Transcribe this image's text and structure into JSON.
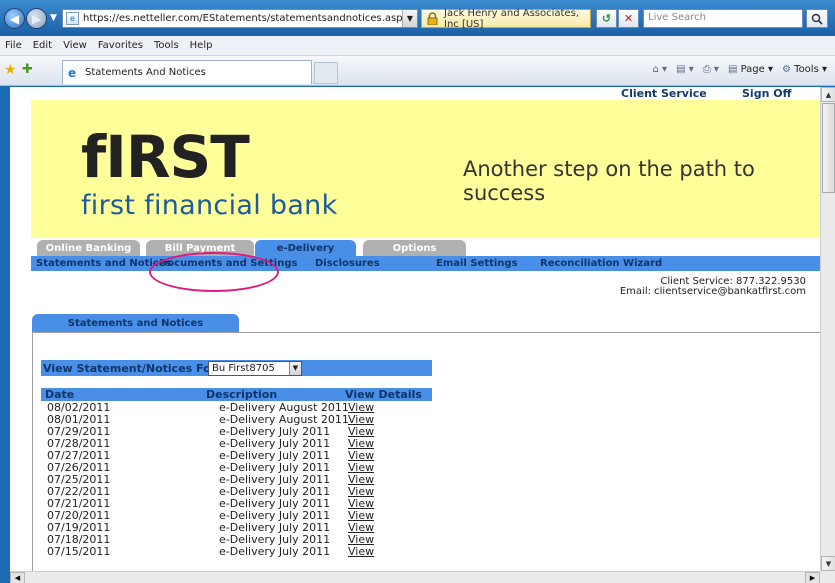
{
  "browser": {
    "url": "https://es.netteller.com/EStatements/statementsandnotices.aspx",
    "security_owner": "Jack Henry and Associates, Inc [US]",
    "search_placeholder": "Live Search",
    "menu": [
      "File",
      "Edit",
      "View",
      "Favorites",
      "Tools",
      "Help"
    ],
    "tab_title": "Statements And Notices",
    "commands": {
      "page": "Page",
      "tools": "Tools"
    }
  },
  "site": {
    "top_links": {
      "client_service": "Client Service",
      "sign_off": "Sign Off"
    },
    "logo_first": "fIRST",
    "logo_subtitle": "first financial bank",
    "tagline": "Another step on the path to success",
    "main_tabs": [
      {
        "label": "Online Banking",
        "active": false
      },
      {
        "label": "Bill Payment",
        "active": false
      },
      {
        "label": "e-Delivery",
        "active": true
      },
      {
        "label": "Options",
        "active": false
      }
    ],
    "sub_nav": [
      "Statements and Notices",
      "Documents and Settings",
      "Disclosures",
      "Email Settings",
      "Reconciliation Wizard"
    ],
    "contact_phone": "Client Service: 877.322.9530",
    "contact_email": "Email: clientservice@bankatfirst.com",
    "section_tab": "Statements and Notices",
    "view_for_label": "View Statement/Notices For:",
    "account_selected": "Bu First8705",
    "table": {
      "headers": [
        "Date",
        "Description",
        "View Details"
      ],
      "link_text": "View",
      "rows": [
        {
          "date": "08/02/2011",
          "description": "e-Delivery August 2011"
        },
        {
          "date": "08/01/2011",
          "description": "e-Delivery August 2011"
        },
        {
          "date": "07/29/2011",
          "description": "e-Delivery July 2011"
        },
        {
          "date": "07/28/2011",
          "description": "e-Delivery July 2011"
        },
        {
          "date": "07/27/2011",
          "description": "e-Delivery July 2011"
        },
        {
          "date": "07/26/2011",
          "description": "e-Delivery July 2011"
        },
        {
          "date": "07/25/2011",
          "description": "e-Delivery July 2011"
        },
        {
          "date": "07/22/2011",
          "description": "e-Delivery July 2011"
        },
        {
          "date": "07/21/2011",
          "description": "e-Delivery July 2011"
        },
        {
          "date": "07/20/2011",
          "description": "e-Delivery July 2011"
        },
        {
          "date": "07/19/2011",
          "description": "e-Delivery July 2011"
        },
        {
          "date": "07/18/2011",
          "description": "e-Delivery July 2011"
        },
        {
          "date": "07/15/2011",
          "description": "e-Delivery July 2011"
        }
      ]
    }
  },
  "colors": {
    "accent_blue": "#4a8fe7",
    "banner_yellow": "#ffff99",
    "highlight": "#e0197d"
  }
}
